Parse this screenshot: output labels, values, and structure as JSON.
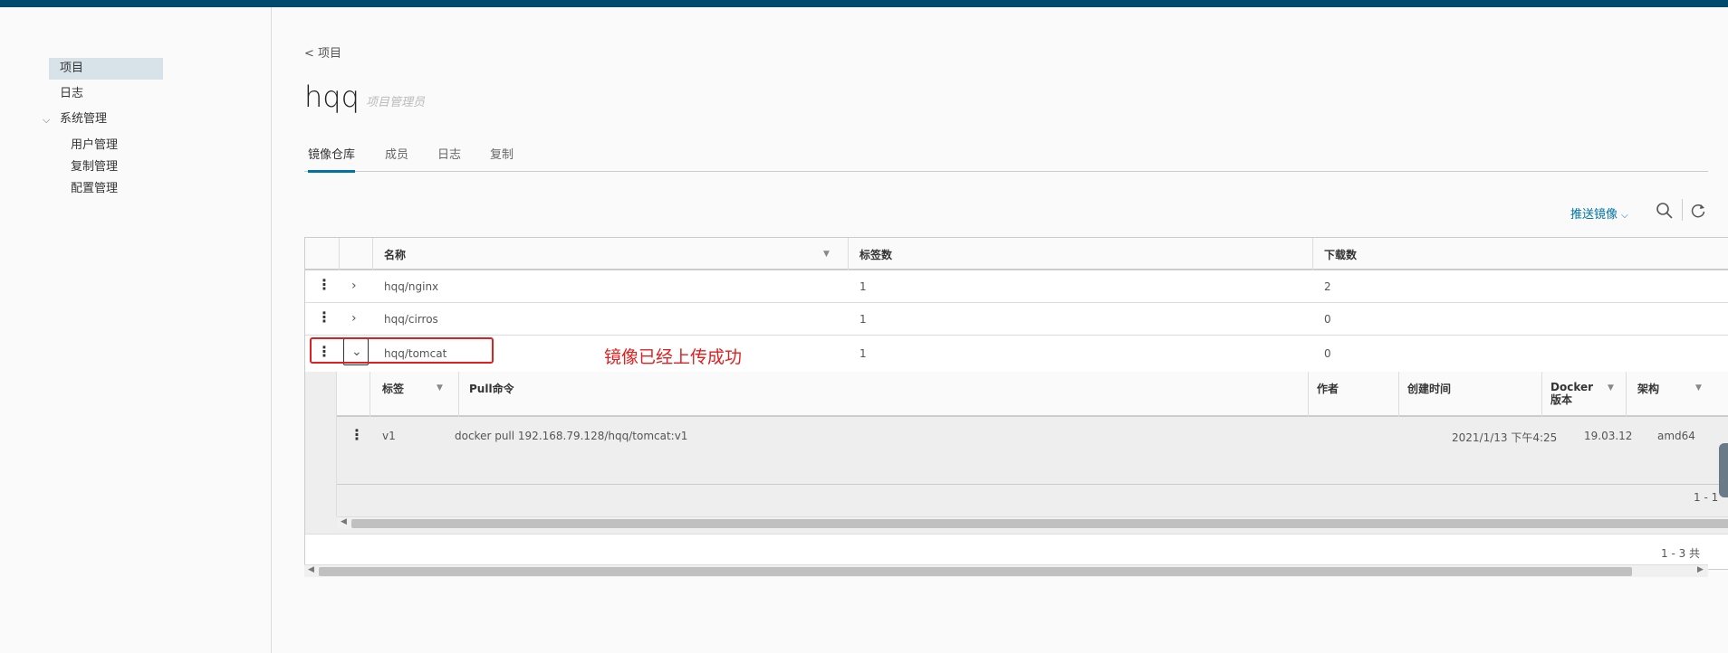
{
  "sidebar": {
    "items": [
      {
        "label": "项目",
        "active": true
      },
      {
        "label": "日志",
        "active": false
      },
      {
        "label": "系统管理",
        "expanded": true
      }
    ],
    "sub_items": [
      "用户管理",
      "复制管理",
      "配置管理"
    ]
  },
  "header": {
    "back_label": "< 项目",
    "project_name": "hqq",
    "role": "项目管理员"
  },
  "tabs": [
    {
      "label": "镜像仓库",
      "active": true
    },
    {
      "label": "成员",
      "active": false
    },
    {
      "label": "日志",
      "active": false
    },
    {
      "label": "复制",
      "active": false
    }
  ],
  "toolbar": {
    "push_label": "推送镜像",
    "search_icon": "search-icon",
    "refresh_icon": "refresh-icon"
  },
  "repo_table": {
    "columns": [
      "名称",
      "标签数",
      "下载数"
    ],
    "rows": [
      {
        "name": "hqq/nginx",
        "tags": "1",
        "pulls": "2"
      },
      {
        "name": "hqq/cirros",
        "tags": "1",
        "pulls": "0"
      },
      {
        "name": "hqq/tomcat",
        "tags": "1",
        "pulls": "0"
      }
    ],
    "footer": "1 - 3 共"
  },
  "tag_table": {
    "columns": [
      "标签",
      "Pull命令",
      "作者",
      "创建时间",
      "Docker 版本",
      "架构"
    ],
    "docker_col_line1": "Docker",
    "docker_col_line2": "版本",
    "rows": [
      {
        "tag": "v1",
        "pull": "docker pull 192.168.79.128/hqq/tomcat:v1",
        "author": "",
        "created": "2021/1/13 下午4:25",
        "docker": "19.03.12",
        "arch": "amd64"
      }
    ],
    "footer": "1 - 1"
  },
  "annotation": "镜像已经上传成功",
  "colors": {
    "accent": "#0072a3",
    "topbar": "#004a70",
    "annotation": "#e02020"
  }
}
